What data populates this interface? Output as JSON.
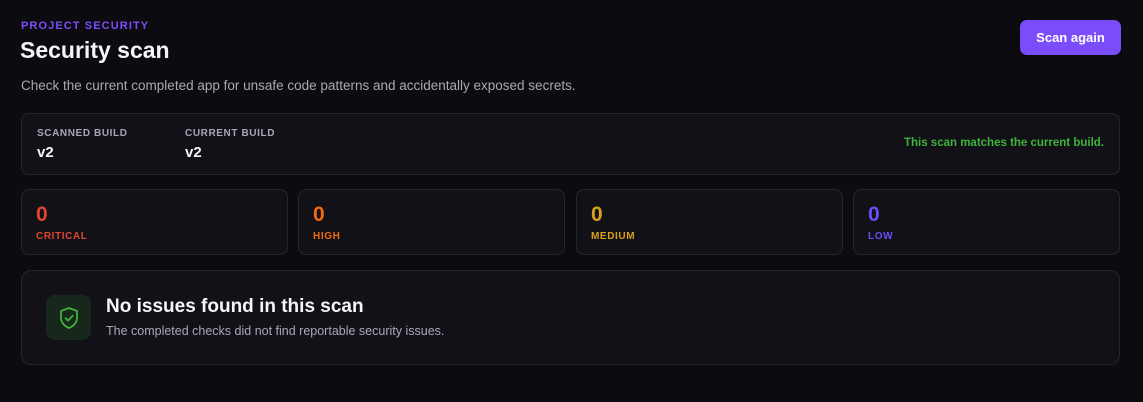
{
  "header": {
    "eyebrow": "PROJECT SECURITY",
    "title": "Security scan",
    "subtitle": "Check the current completed app for unsafe code patterns and accidentally exposed secrets.",
    "scan_button_label": "Scan again"
  },
  "build": {
    "scanned_label": "SCANNED BUILD",
    "scanned_value": "v2",
    "current_label": "CURRENT BUILD",
    "current_value": "v2",
    "status_text": "This scan matches the current build."
  },
  "severity": [
    {
      "count": "0",
      "label": "CRITICAL",
      "color": "#e0452d"
    },
    {
      "count": "0",
      "label": "HIGH",
      "color": "#f26a12"
    },
    {
      "count": "0",
      "label": "MEDIUM",
      "color": "#d9a01a"
    },
    {
      "count": "0",
      "label": "LOW",
      "color": "#6a4dfb"
    }
  ],
  "result": {
    "icon": "shield-check-icon",
    "title": "No issues found in this scan",
    "description": "The completed checks did not find reportable security issues."
  },
  "colors": {
    "accent": "#7b4dfa",
    "success": "#3fb33a",
    "background": "#0b0b10",
    "card": "#111117"
  }
}
